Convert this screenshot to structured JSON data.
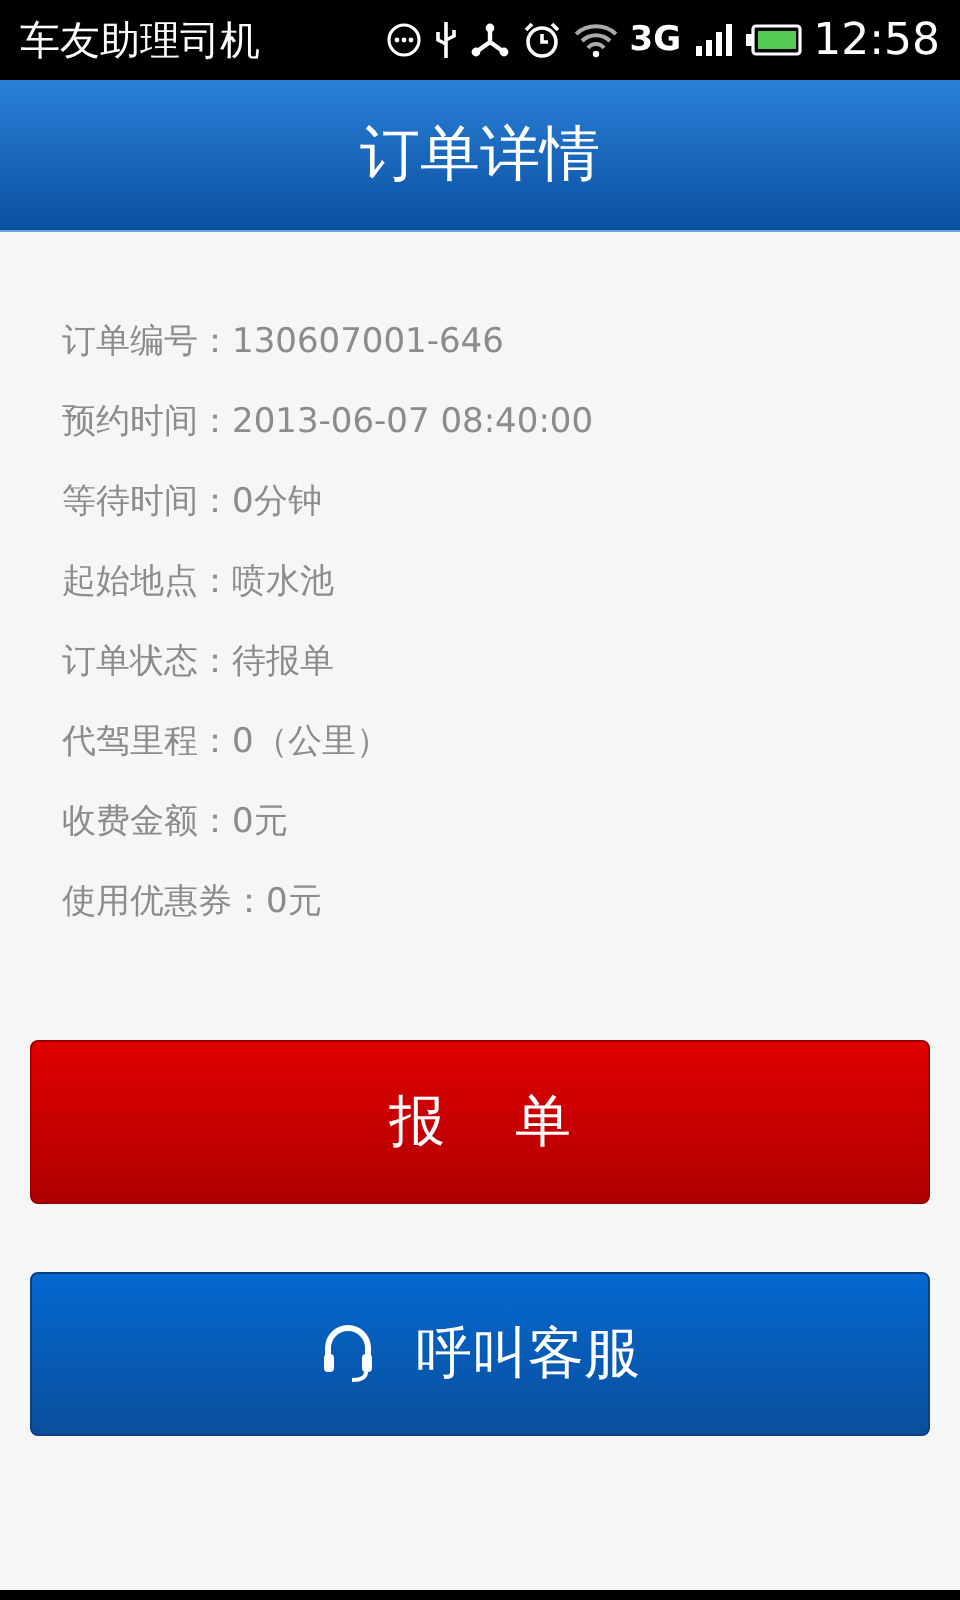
{
  "status_bar": {
    "app_name": "车友助理司机",
    "network": "3G",
    "time": "12:58"
  },
  "header": {
    "title": "订单详情"
  },
  "details": [
    {
      "text": "订单编号：130607001-646"
    },
    {
      "text": "预约时间：2013-06-07 08:40:00"
    },
    {
      "text": "等待时间：0分钟"
    },
    {
      "text": "起始地点：喷水池"
    },
    {
      "text": "订单状态：待报单"
    },
    {
      "text": "代驾里程：0（公里）"
    },
    {
      "text": "收费金额：0元"
    },
    {
      "text": "使用优惠券：0元"
    }
  ],
  "buttons": [
    {
      "label": "报 单",
      "kind": "report"
    },
    {
      "label": "呼叫客服",
      "kind": "support"
    }
  ]
}
